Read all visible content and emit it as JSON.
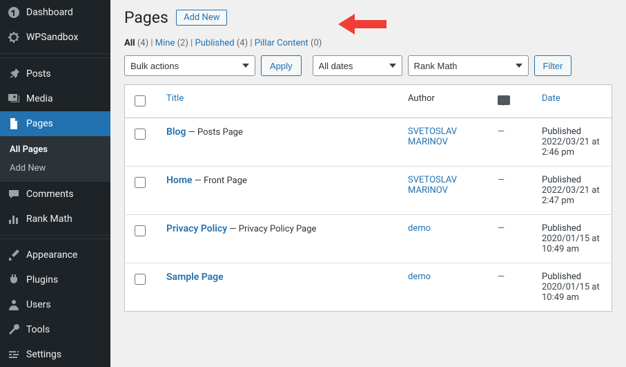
{
  "sidebar": {
    "items": [
      {
        "label": "Dashboard"
      },
      {
        "label": "WPSandbox"
      },
      {
        "label": "Posts"
      },
      {
        "label": "Media"
      },
      {
        "label": "Pages"
      },
      {
        "label": "Comments"
      },
      {
        "label": "Rank Math"
      },
      {
        "label": "Appearance"
      },
      {
        "label": "Plugins"
      },
      {
        "label": "Users"
      },
      {
        "label": "Tools"
      },
      {
        "label": "Settings"
      }
    ],
    "sub": [
      {
        "label": "All Pages"
      },
      {
        "label": "Add New"
      }
    ]
  },
  "header": {
    "title": "Pages",
    "add_new": "Add New"
  },
  "filters": {
    "rows": [
      {
        "label": "All",
        "count": "(4)"
      },
      {
        "label": "Mine",
        "count": "(2)"
      },
      {
        "label": "Published",
        "count": "(4)"
      },
      {
        "label": "Pillar Content",
        "count": "(0)"
      }
    ]
  },
  "controls": {
    "bulk": "Bulk actions",
    "apply": "Apply",
    "dates": "All dates",
    "rank": "Rank Math",
    "filter": "Filter"
  },
  "columns": {
    "title": "Title",
    "author": "Author",
    "date": "Date"
  },
  "rows": [
    {
      "title": "Blog",
      "state": " — Posts Page",
      "author": "SVETOSLAV MARINOV",
      "comments": "—",
      "pub_state": "Published",
      "pub_date": "2022/03/21 at 2:46 pm"
    },
    {
      "title": "Home",
      "state": " — Front Page",
      "author": "SVETOSLAV MARINOV",
      "comments": "—",
      "pub_state": "Published",
      "pub_date": "2022/03/21 at 2:47 pm"
    },
    {
      "title": "Privacy Policy",
      "state": " — Privacy Policy Page",
      "author": "demo",
      "comments": "—",
      "pub_state": "Published",
      "pub_date": "2020/01/15 at 10:49 am"
    },
    {
      "title": "Sample Page",
      "state": "",
      "author": "demo",
      "comments": "—",
      "pub_state": "Published",
      "pub_date": "2020/01/15 at 10:49 am"
    }
  ]
}
